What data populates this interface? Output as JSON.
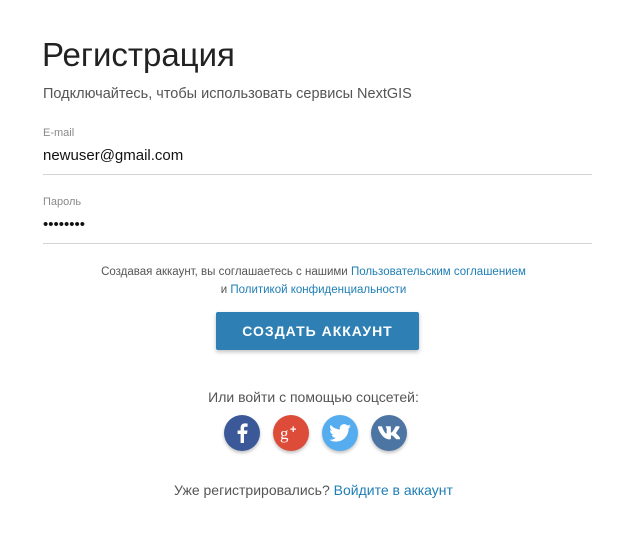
{
  "header": {
    "title": "Регистрация",
    "subtitle": "Подключайтесь, чтобы использовать сервисы NextGIS"
  },
  "form": {
    "email": {
      "label": "E-mail",
      "value": "newuser@gmail.com"
    },
    "password": {
      "label": "Пароль",
      "value": "••••••••"
    }
  },
  "agreement": {
    "text_before": "Создавая аккаунт, вы соглашаетесь с нашими",
    "terms_link": "Пользовательским соглашением",
    "conjunction": "и",
    "privacy_link": "Политикой конфиденциальности"
  },
  "create_button": {
    "label": "СОЗДАТЬ АККАУНТ"
  },
  "social": {
    "label": "Или войти с помощью соцсетей:",
    "buttons": [
      {
        "icon": "facebook-icon",
        "color": "#3b5998"
      },
      {
        "icon": "google-plus-icon",
        "color": "#dd4b39"
      },
      {
        "icon": "twitter-icon",
        "color": "#55acee"
      },
      {
        "icon": "vk-icon",
        "color": "#4c75a3"
      }
    ]
  },
  "login": {
    "question": "Уже регистрировались?",
    "link": "Войдите в аккаунт"
  },
  "colors": {
    "accent": "#2e7fb3",
    "link": "#1e7eb5"
  }
}
